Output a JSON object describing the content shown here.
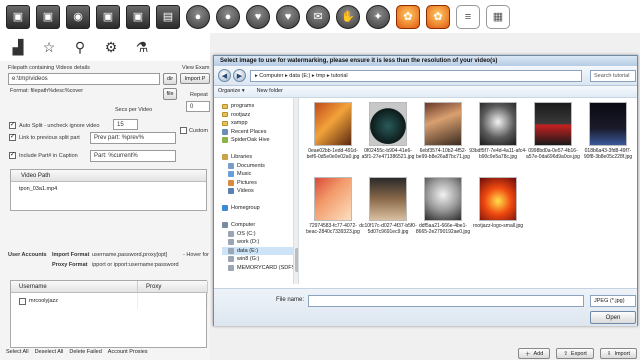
{
  "iconbar": {
    "icons": [
      "photo-icon",
      "photo-icon",
      "eye-icon",
      "photo-icon",
      "photo-icon",
      "clapperboard-icon",
      "person-icon",
      "person-icon",
      "heart-icon",
      "heart-icon",
      "speech-bubble-icon",
      "picture-hand-icon",
      "satellite-icon",
      "watermark-icon",
      "watermark-icon",
      "list-icon",
      "grid-icon"
    ]
  },
  "row2": {
    "icons": [
      "chart-icon",
      "star-icon",
      "magnifier-icon",
      "gears-icon",
      "flask-icon"
    ]
  },
  "left": {
    "filepath_label": "Filepath containing Videos details",
    "filepath_value": "e:\\tmp\\videos",
    "dir_button": "dir",
    "file_button": "file",
    "format_label": "Format: filepath%desc%cover",
    "secs_label": "Secs per Video",
    "auto_split_label": "Auto Split - uncheck ignore video",
    "auto_split_value": "15",
    "link_label": "Link to previous split part",
    "link_value": "Prev part: %prev%",
    "include_label": "Include Part# in Caption",
    "include_value": "Part: %current%",
    "video_path_header": "Video Path",
    "video_path_row": "tpon_03a1.mp4",
    "user_accounts_label": "User Accounts",
    "import_format_label": "Import Format",
    "import_format_value": "username,password,proxy[opt]",
    "hover_label": "- Hover for",
    "proxy_format_label": "Proxy Format",
    "proxy_format_value": "ipport or ipport:username:password",
    "username_header": "Username",
    "proxy_header": "Proxy",
    "username_row": "mrcoolyjazz"
  },
  "mid": {
    "view_exam": "View Exam",
    "import_p": "Import P",
    "repeat": "Repeat",
    "zero": "0",
    "custom": "Custom"
  },
  "bottom_links": [
    "Select All",
    "Deselect All",
    "Delete Failed",
    "Account Proxies"
  ],
  "bottom_buttons": {
    "add": "Add",
    "export": "Export",
    "import": "Import"
  },
  "dialog": {
    "title": "Select image to use for watermarking, please ensure it is less than the resolution of your video(s)",
    "breadcrumb": "▸ Computer ▸ data (E:) ▸ tmp ▸ tutorial",
    "search_placeholder": "Search tutorial",
    "organize": "Organize ▾",
    "new_folder": "New folder",
    "nav_items": [
      {
        "label": "programs",
        "type": "folder"
      },
      {
        "label": "rootjazz",
        "type": "folder"
      },
      {
        "label": "xampp",
        "type": "folder"
      },
      {
        "label": "Recent Places",
        "type": "places"
      },
      {
        "label": "SpiderOak Hive",
        "type": "hive"
      },
      {
        "label": "",
        "type": "blank"
      },
      {
        "label": "Libraries",
        "type": "libraries"
      },
      {
        "label": "Documents",
        "type": "docs"
      },
      {
        "label": "Music",
        "type": "music"
      },
      {
        "label": "Pictures",
        "type": "pics"
      },
      {
        "label": "Videos",
        "type": "videos"
      },
      {
        "label": "",
        "type": "blank"
      },
      {
        "label": "Homegroup",
        "type": "home"
      },
      {
        "label": "",
        "type": "blank"
      },
      {
        "label": "Computer",
        "type": "computer"
      },
      {
        "label": "OS (C:)",
        "type": "drive"
      },
      {
        "label": "work (D:)",
        "type": "drive"
      },
      {
        "label": "data (E:)",
        "type": "drive",
        "selected": true
      },
      {
        "label": "win8 (G:)",
        "type": "drive"
      },
      {
        "label": "MEMORYCARD (SDFSDA",
        "type": "drive"
      }
    ],
    "files": [
      {
        "name": "0eae02bb-1edd-491d-bef6-0d5e0e0e02a0.jpg"
      },
      {
        "name": "0f02455c-b904-41e6-a5f1-27e471386521.jpg"
      },
      {
        "name": "6ebf3574-10b2-4f52-be99-b8e26a87bc71.jpg"
      },
      {
        "name": "93bdf5f7-7e4d-4a11-afc4-b90c9e5a78c.jpg"
      },
      {
        "name": "0998bd0a-0e57-4b16-a57e-0da696d9a0ce.jpg"
      },
      {
        "name": "018b6a43-3fd8-49f7-90f8-3b8e05c228f.jpg"
      },
      {
        "name": "72974583-fc77-4072-beac-2840c7339323.jpg"
      },
      {
        "name": "dc10f17c-d027-4f37-b5f0-5d07c9691ec9.jpg"
      },
      {
        "name": "ddf5aa21-666e-4be1-8665-2e2790192ae0.jpg"
      },
      {
        "name": "rootjazz-logo-small.jpg"
      }
    ],
    "file_name_label": "File name:",
    "file_type": "JPEG (*.jpg)",
    "open_button": "Open"
  }
}
